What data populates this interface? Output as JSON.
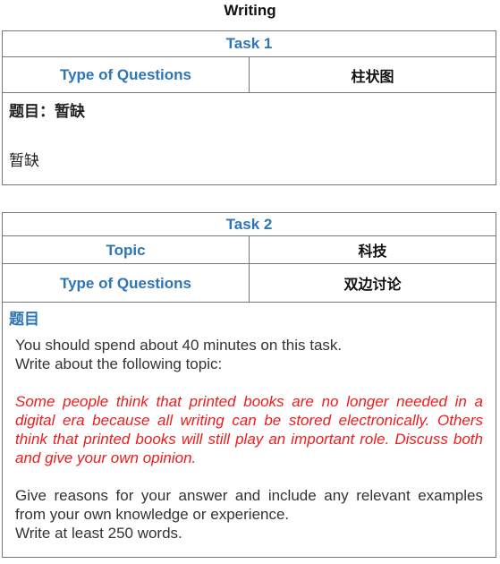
{
  "page_title": "Writing",
  "task1": {
    "header": "Task 1",
    "rows": [
      {
        "label": "Type of Questions",
        "value": "柱状图"
      }
    ],
    "prompt_heading": "题目：暂缺",
    "prompt_body": "暂缺"
  },
  "task2": {
    "header": "Task 2",
    "rows": [
      {
        "label": "Topic",
        "value": "科技"
      },
      {
        "label": "Type of Questions",
        "value": "双边讨论"
      }
    ],
    "prompt_heading": "题目",
    "instructions": [
      "You should spend about 40 minutes on this task.",
      "Write about the following topic:"
    ],
    "topic_text": "Some people think that printed books are no longer needed in a digital era because all writing can be stored electronically. Others think that printed books will still play an important role. Discuss both and give your own opinion.",
    "closing_paragraph": "Give reasons for your answer and include any relevant examples from your own knowledge or experience.",
    "word_requirement": "Write at least 250 words."
  },
  "colors": {
    "label_blue": "#2e75b6",
    "topic_red": "#ee1c1c",
    "border": "#777777"
  }
}
